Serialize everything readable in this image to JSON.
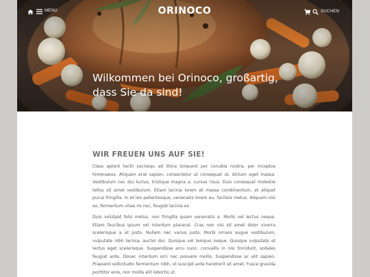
{
  "header": {
    "menu_label": "MENU",
    "logo": "ORINOCO",
    "search_label": "SUCHEN"
  },
  "hero": {
    "title": "Wilkommen bei Orinoco, großartig, dass Sie da sind!"
  },
  "main": {
    "section_title": "WIR FREUEN UNS AUF SIE!",
    "paragraphs": [
      "Class aptent taciti sociosqu ad litora torquent per conubia nostra, per inceptos himenaeos. Aliquam erat sapien, consectetur ut consequat ut, dictum eget massa. Vestibulum nec dui luctus, tristique magna a, cursus risus. Duis consequat molestie tellus sit amet vestibulum. Etiam lacinia lorem et massa condimentum, et aliquet purus fringilla. In et leo pellentesque, venenatis lorem eu, facilisis metus. Aliquam nisi ex, fermentum vitae mi nec, feugiat lacinia ex.",
      "Duis volutpat felis metus, non fringilla quam venenatis a. Morbi vel lectus neque. Etiam faucibus ipsum vel interdum placerat. Cras non nisi sit amet dolor viverra scelerisque a at justo. Nullam nec varius justo. Morbi ornare augue vestibulum, vulputate nibh lacinia, auctor dui. Quisque vel tempus neque. Quisque vulputate et lectus eget scelerisque. Suspendisse arcu nunc, convallis in nisi tincidunt, sodales feugiat ante. Donec interdum orci nec posuere mollis. Suspendisse ac elit sapien. Praesent sollicitudin fermentum nibh, ut suscipit ante hendrerit sit amet. Fusce gravida porttitor eros, non mollis elit lobortis ut."
    ]
  },
  "colors": {
    "page_background": "#cfcdc9",
    "content_background": "#ffffff",
    "text": "#555555",
    "heading": "#6f6f6f",
    "header_text": "#ffffff"
  }
}
